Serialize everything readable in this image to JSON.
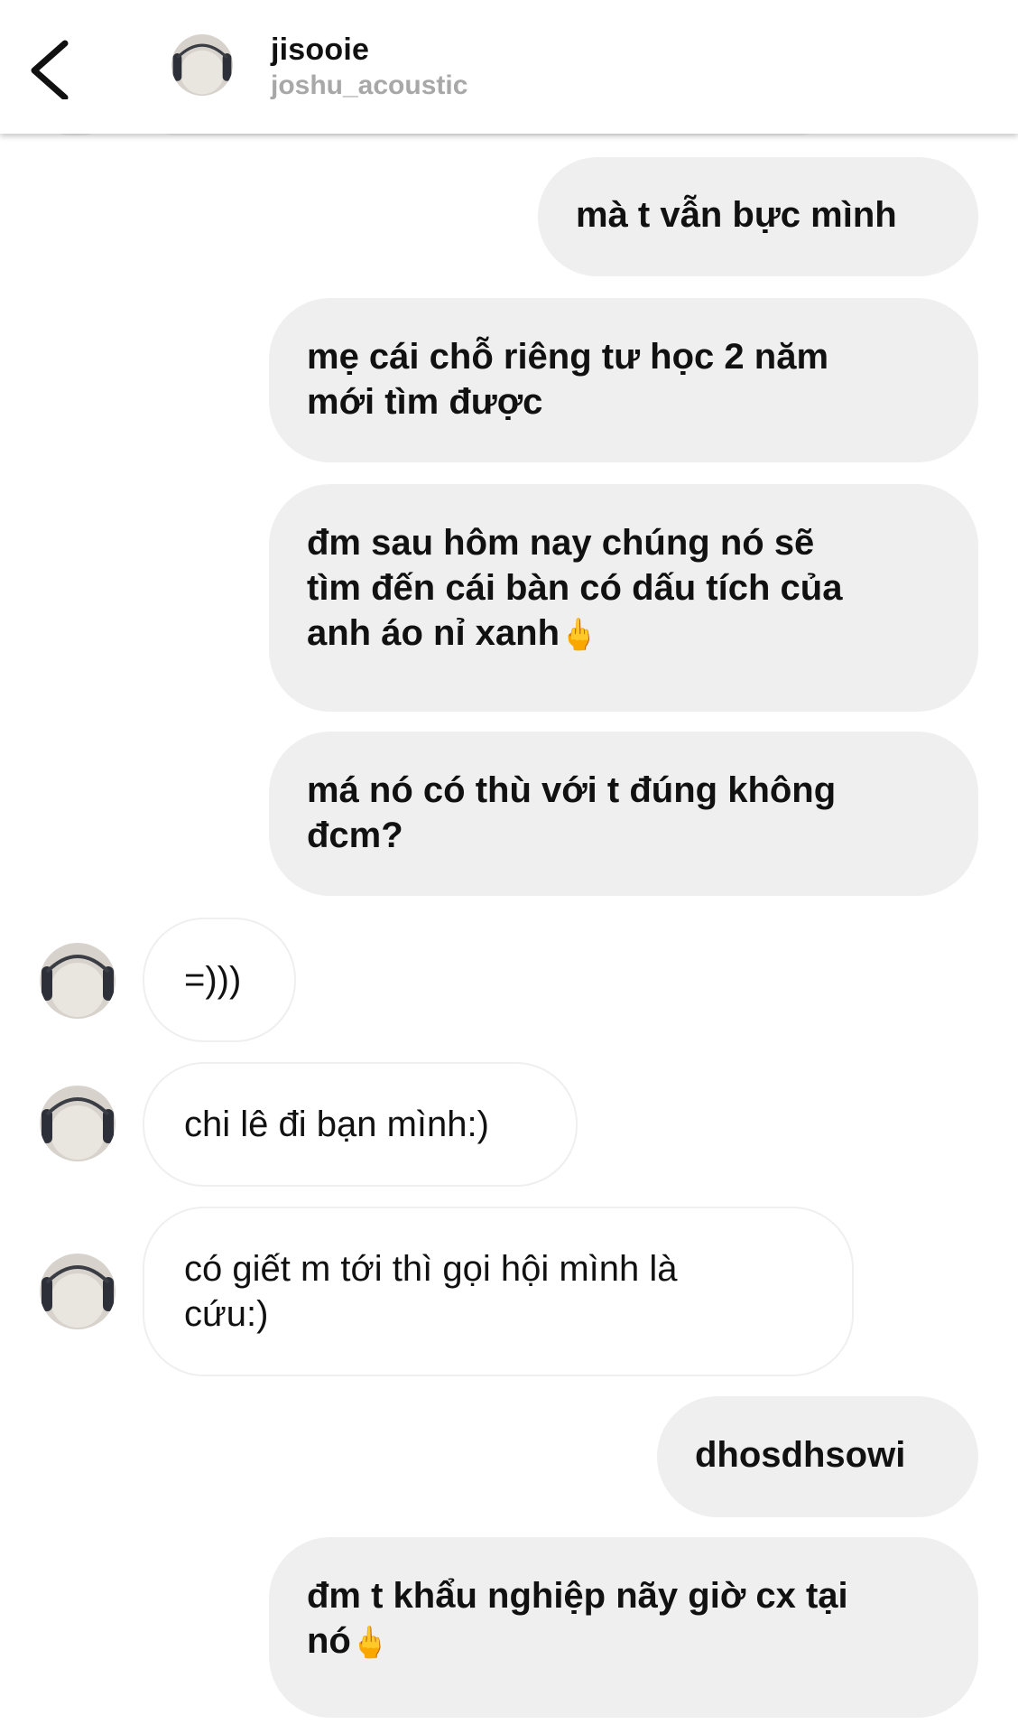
{
  "header": {
    "back_icon": "chevron-left-icon",
    "name": "jisooie",
    "username": "joshu_acoustic"
  },
  "messages": [
    {
      "from": "me",
      "lines": [
        "mà t vẫn bực mình"
      ]
    },
    {
      "from": "me",
      "lines": [
        "mẹ cái chỗ riêng tư học 2 năm",
        "mới tìm được"
      ]
    },
    {
      "from": "me",
      "lines": [
        "đm sau hôm nay chúng nó sẽ",
        "tìm đến cái bàn có dấu tích của",
        "anh áo nỉ xanh"
      ],
      "emoji": "🖕"
    },
    {
      "from": "me",
      "lines": [
        "má nó có thù với t đúng không",
        "đcm?"
      ]
    },
    {
      "from": "them",
      "lines": [
        "=)))"
      ]
    },
    {
      "from": "them",
      "lines": [
        "chi lê đi bạn mình:)"
      ]
    },
    {
      "from": "them",
      "lines": [
        "có giết m tới thì gọi hội mình là",
        "cứu:)"
      ]
    },
    {
      "from": "me",
      "lines": [
        "dhosdhsowi"
      ]
    },
    {
      "from": "me",
      "lines": [
        "đm t khẩu nghiệp nãy giờ cx tại",
        "nó"
      ],
      "emoji": "🖕"
    }
  ],
  "colors": {
    "outgoing_bubble": "#efefef",
    "incoming_border": "#efefef",
    "username_gray": "#a8a8a8",
    "text": "#111111"
  }
}
